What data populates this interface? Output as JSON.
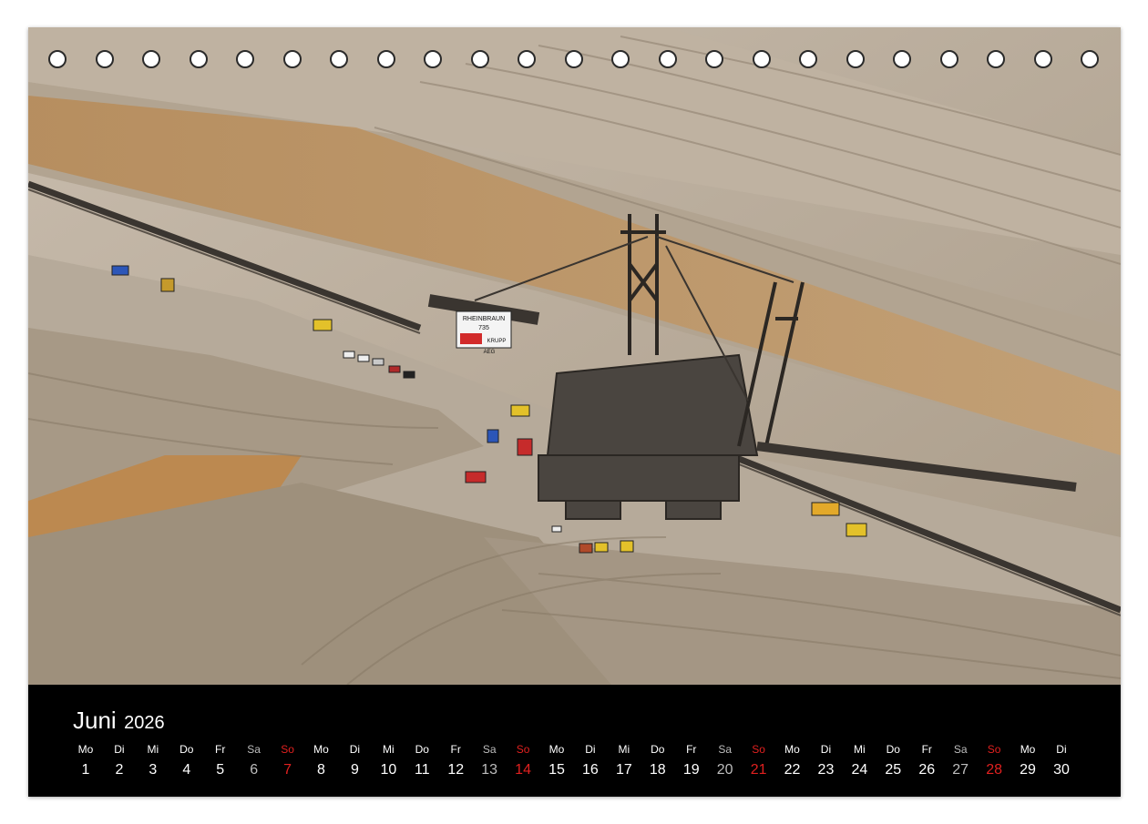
{
  "calendar": {
    "month": "Juni",
    "year": "2026",
    "days": [
      {
        "abbr": "Mo",
        "num": "1",
        "type": "weekday"
      },
      {
        "abbr": "Di",
        "num": "2",
        "type": "weekday"
      },
      {
        "abbr": "Mi",
        "num": "3",
        "type": "weekday"
      },
      {
        "abbr": "Do",
        "num": "4",
        "type": "weekday"
      },
      {
        "abbr": "Fr",
        "num": "5",
        "type": "weekday"
      },
      {
        "abbr": "Sa",
        "num": "6",
        "type": "saturday"
      },
      {
        "abbr": "So",
        "num": "7",
        "type": "sunday"
      },
      {
        "abbr": "Mo",
        "num": "8",
        "type": "weekday"
      },
      {
        "abbr": "Di",
        "num": "9",
        "type": "weekday"
      },
      {
        "abbr": "Mi",
        "num": "10",
        "type": "weekday"
      },
      {
        "abbr": "Do",
        "num": "11",
        "type": "weekday"
      },
      {
        "abbr": "Fr",
        "num": "12",
        "type": "weekday"
      },
      {
        "abbr": "Sa",
        "num": "13",
        "type": "saturday"
      },
      {
        "abbr": "So",
        "num": "14",
        "type": "sunday"
      },
      {
        "abbr": "Mo",
        "num": "15",
        "type": "weekday"
      },
      {
        "abbr": "Di",
        "num": "16",
        "type": "weekday"
      },
      {
        "abbr": "Mi",
        "num": "17",
        "type": "weekday"
      },
      {
        "abbr": "Do",
        "num": "18",
        "type": "weekday"
      },
      {
        "abbr": "Fr",
        "num": "19",
        "type": "weekday"
      },
      {
        "abbr": "Sa",
        "num": "20",
        "type": "saturday"
      },
      {
        "abbr": "So",
        "num": "21",
        "type": "sunday"
      },
      {
        "abbr": "Mo",
        "num": "22",
        "type": "weekday"
      },
      {
        "abbr": "Di",
        "num": "23",
        "type": "weekday"
      },
      {
        "abbr": "Mi",
        "num": "24",
        "type": "weekday"
      },
      {
        "abbr": "Do",
        "num": "25",
        "type": "weekday"
      },
      {
        "abbr": "Fr",
        "num": "26",
        "type": "weekday"
      },
      {
        "abbr": "Sa",
        "num": "27",
        "type": "saturday"
      },
      {
        "abbr": "So",
        "num": "28",
        "type": "sunday"
      },
      {
        "abbr": "Mo",
        "num": "29",
        "type": "weekday"
      },
      {
        "abbr": "Di",
        "num": "30",
        "type": "weekday"
      }
    ]
  },
  "photo": {
    "sign_line1": "RHEINBRAUN",
    "sign_line2": "735",
    "sign_line3": "KRUPP",
    "sign_line4": "AEG"
  },
  "colors": {
    "band_background": "#000000",
    "sunday_text": "#e0201f",
    "saturday_text": "#bdbdbd",
    "weekday_text": "#ffffff"
  }
}
